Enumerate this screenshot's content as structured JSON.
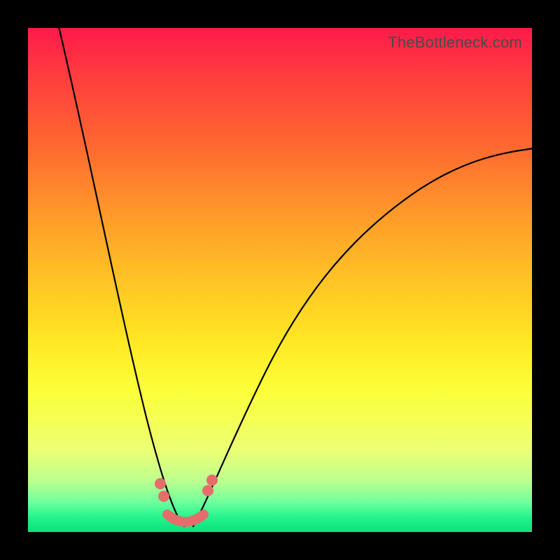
{
  "credit": "TheBottleneck.com",
  "colors": {
    "frame": "#000000",
    "curve": "#000000",
    "marker": "#e56d6b"
  },
  "chart_data": {
    "type": "line",
    "title": "",
    "xlabel": "",
    "ylabel": "",
    "xlim": [
      0,
      100
    ],
    "ylim": [
      0,
      100
    ],
    "grid": false,
    "legend": false,
    "description": "Bottleneck-style V-shaped curve over a vertical rainbow gradient (top=red=worst, bottom=green=best). Minimum is near x≈31, both branches rise away from it; right branch flattens near the top-right.",
    "series": [
      {
        "name": "left-branch",
        "x": [
          6,
          8,
          10,
          12,
          14,
          16,
          18,
          20,
          22,
          24,
          26,
          28,
          30
        ],
        "y": [
          100,
          91,
          82,
          73,
          64,
          55,
          46,
          37,
          28,
          20,
          12,
          6,
          2
        ]
      },
      {
        "name": "right-branch",
        "x": [
          32,
          34,
          36,
          38,
          40,
          44,
          48,
          52,
          56,
          60,
          66,
          72,
          78,
          84,
          90,
          96,
          100
        ],
        "y": [
          2,
          5,
          9,
          13,
          17,
          25,
          32,
          39,
          45,
          50,
          57,
          62,
          66,
          70,
          73,
          75,
          76
        ]
      }
    ],
    "markers": [
      {
        "x": 26.0,
        "y": 9.5
      },
      {
        "x": 26.8,
        "y": 7.0
      },
      {
        "x": 35.5,
        "y": 8.0
      },
      {
        "x": 36.3,
        "y": 10.0
      }
    ],
    "marker_arc": {
      "x0": 27.5,
      "y0": 3.3,
      "x1": 35.0,
      "y1": 3.3,
      "cx": 31.0,
      "cy": 1.6
    }
  }
}
